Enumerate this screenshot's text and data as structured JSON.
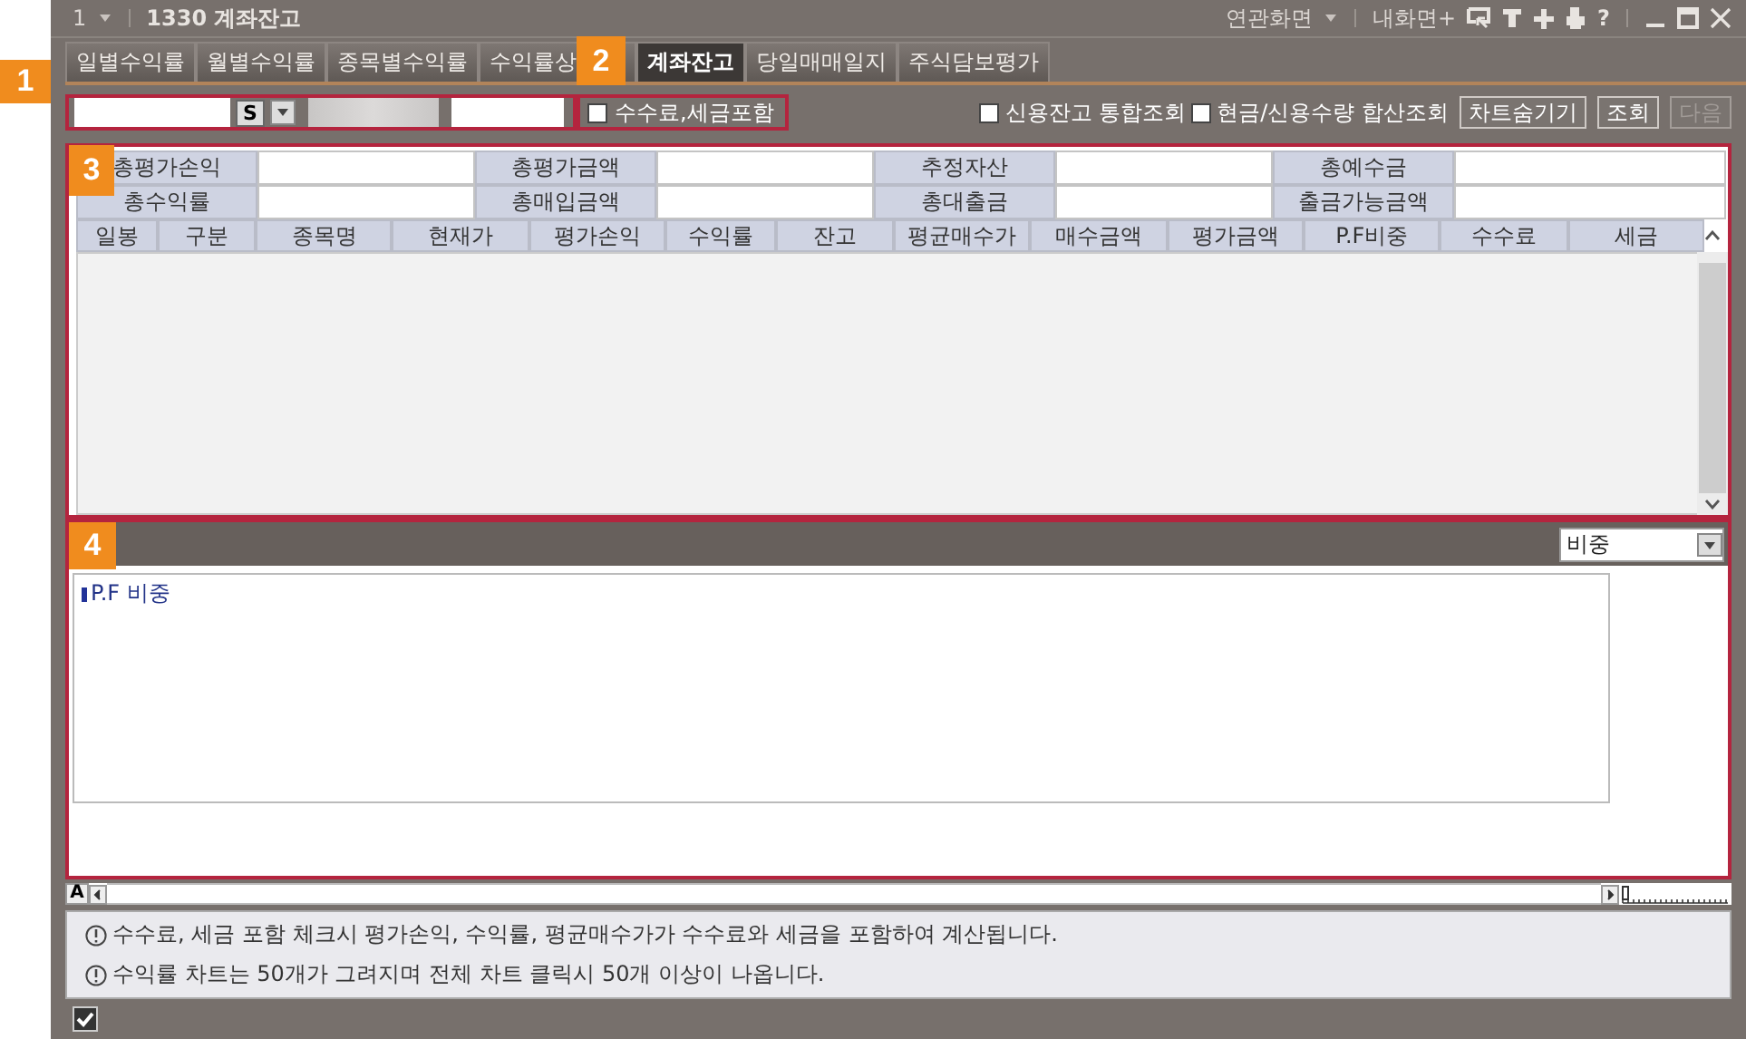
{
  "title_bar": {
    "screen_no": "1",
    "title": "1330 계좌잔고",
    "related": "연관화면",
    "my_screen": "내화면+",
    "help": "?"
  },
  "callouts": [
    "1",
    "2",
    "3",
    "4"
  ],
  "tabs": [
    {
      "label": "일별수익률",
      "selected": false
    },
    {
      "label": "월별수익률",
      "selected": false
    },
    {
      "label": "종목별수익률",
      "selected": false
    },
    {
      "label": "수익률상",
      "selected": false
    },
    {
      "label": "계좌잔고",
      "selected": true
    },
    {
      "label": "당일매매일지",
      "selected": false
    },
    {
      "label": "주식담보평가",
      "selected": false
    }
  ],
  "toolbar": {
    "s_button": "S",
    "fee_option": {
      "label": "수수료,세금포함",
      "checked": false
    },
    "options": [
      {
        "label": "신용잔고 통합조회",
        "checked": false
      },
      {
        "label": "현금/신용수량 합산조회",
        "checked": false
      }
    ],
    "buttons": [
      {
        "label": "차트숨기기",
        "disabled": false
      },
      {
        "label": "조회",
        "disabled": false
      },
      {
        "label": "다음",
        "disabled": true
      }
    ]
  },
  "summary": [
    [
      "총평가손익",
      "총평가금액",
      "추정자산",
      "총예수금"
    ],
    [
      "총수익률",
      "총매입금액",
      "총대출금",
      "출금가능금액"
    ]
  ],
  "table": {
    "columns": [
      "일봉",
      "구분",
      "종목명",
      "현재가",
      "평가손익",
      "수익률",
      "잔고",
      "평균매수가",
      "매수금액",
      "평가금액",
      "P.F비중",
      "수수료",
      "세금"
    ]
  },
  "chart_panel": {
    "dropdown": "비중",
    "legend": "P.F 비중"
  },
  "font_button": "A",
  "notes": [
    "수수료, 세금 포함 체크시 평가손익, 수익률, 평균매수가가 수수료와 세금을 포함하여 계산됩니다.",
    "수익률 차트는 50개가 그려지며 전체 차트 클릭시 50개 이상이 나옵니다."
  ],
  "status_checkbox": {
    "checked": true
  }
}
